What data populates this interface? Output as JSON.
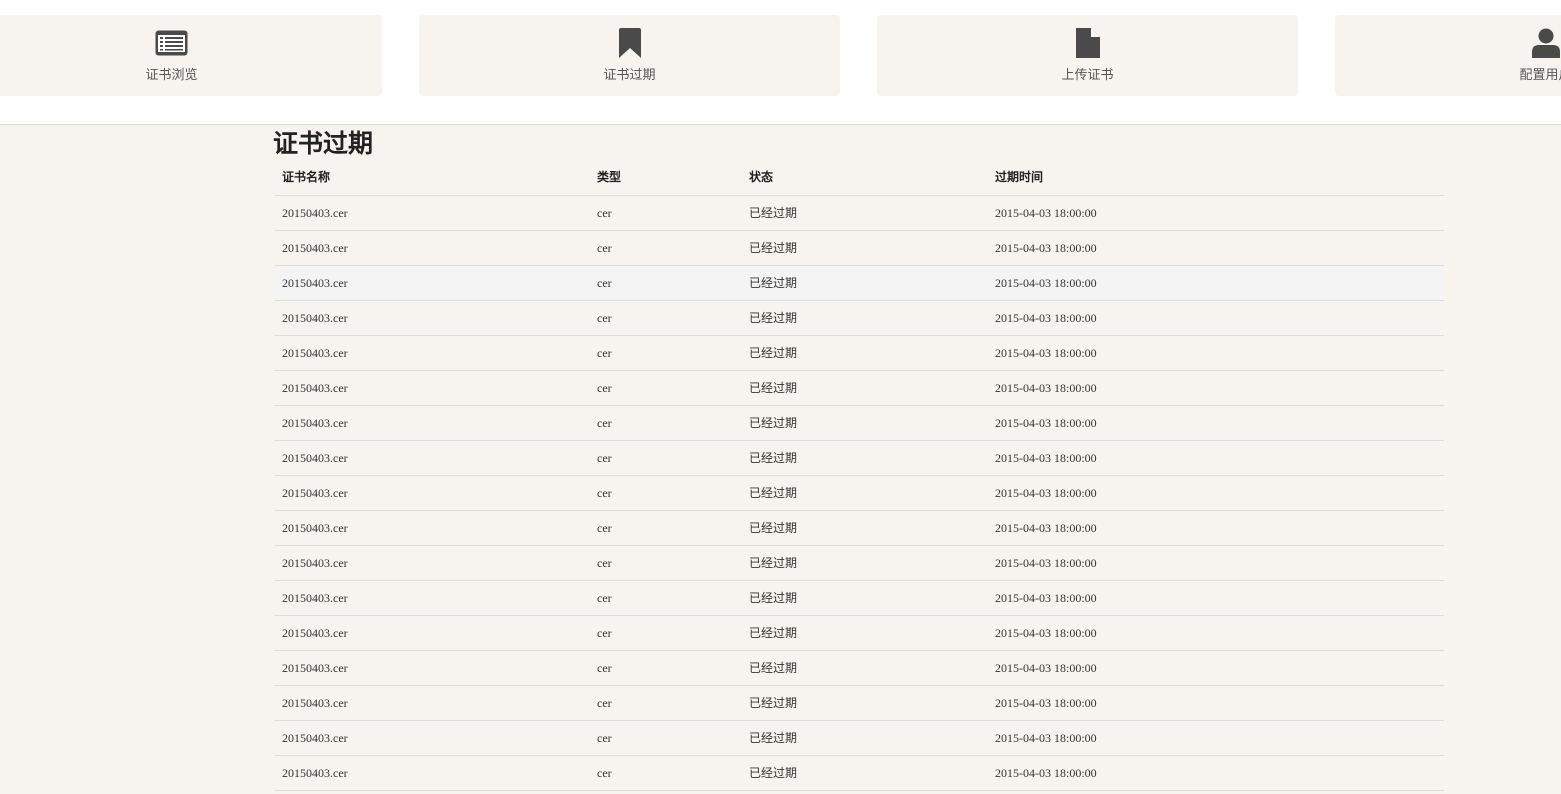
{
  "nav": {
    "tiles": [
      {
        "label": "证书浏览",
        "icon": "list-icon"
      },
      {
        "label": "证书过期",
        "icon": "bookmark-icon"
      },
      {
        "label": "上传证书",
        "icon": "file-icon"
      },
      {
        "label": "配置用户",
        "icon": "user-icon"
      }
    ]
  },
  "page": {
    "title": "证书过期"
  },
  "table": {
    "columns": [
      "证书名称",
      "类型",
      "状态",
      "过期时间"
    ],
    "rows": [
      [
        "20150403.cer",
        "cer",
        "已经过期",
        "2015-04-03 18:00:00"
      ],
      [
        "20150403.cer",
        "cer",
        "已经过期",
        "2015-04-03 18:00:00"
      ],
      [
        "20150403.cer",
        "cer",
        "已经过期",
        "2015-04-03 18:00:00"
      ],
      [
        "20150403.cer",
        "cer",
        "已经过期",
        "2015-04-03 18:00:00"
      ],
      [
        "20150403.cer",
        "cer",
        "已经过期",
        "2015-04-03 18:00:00"
      ],
      [
        "20150403.cer",
        "cer",
        "已经过期",
        "2015-04-03 18:00:00"
      ],
      [
        "20150403.cer",
        "cer",
        "已经过期",
        "2015-04-03 18:00:00"
      ],
      [
        "20150403.cer",
        "cer",
        "已经过期",
        "2015-04-03 18:00:00"
      ],
      [
        "20150403.cer",
        "cer",
        "已经过期",
        "2015-04-03 18:00:00"
      ],
      [
        "20150403.cer",
        "cer",
        "已经过期",
        "2015-04-03 18:00:00"
      ],
      [
        "20150403.cer",
        "cer",
        "已经过期",
        "2015-04-03 18:00:00"
      ],
      [
        "20150403.cer",
        "cer",
        "已经过期",
        "2015-04-03 18:00:00"
      ],
      [
        "20150403.cer",
        "cer",
        "已经过期",
        "2015-04-03 18:00:00"
      ],
      [
        "20150403.cer",
        "cer",
        "已经过期",
        "2015-04-03 18:00:00"
      ],
      [
        "20150403.cer",
        "cer",
        "已经过期",
        "2015-04-03 18:00:00"
      ],
      [
        "20150403.cer",
        "cer",
        "已经过期",
        "2015-04-03 18:00:00"
      ],
      [
        "20150403.cer",
        "cer",
        "已经过期",
        "2015-04-03 18:00:00"
      ]
    ]
  },
  "colors": {
    "tile_background": "#f7f4ef",
    "icon": "#4a4a4a",
    "hover_row": "#f4f4f4"
  }
}
